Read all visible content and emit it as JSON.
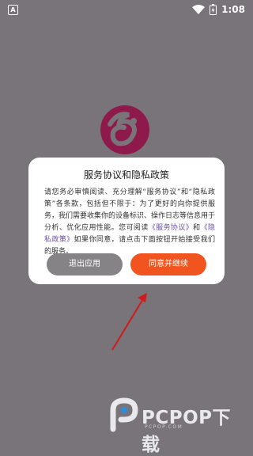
{
  "status_bar": {
    "left_badge": "A",
    "time": "1:08"
  },
  "dialog": {
    "title": "服务协议和隐私政策",
    "body_part1": "请您务必审慎阅读、充分理解“服务协议”和“隐私政策”各条款，包括但不限于：为了更好的向你提供服务，我们需要收集你的设备标识、操作日志等信息用于分析、优化应用性能。您可阅读",
    "link_service": "《服务协议》",
    "body_and": "和",
    "link_privacy": "《隐私政策》",
    "body_part2": "如果你同意，请点击下面按钮开始接受我们的服务。",
    "exit_label": "退出应用",
    "agree_label": "同意并继续"
  },
  "watermark": {
    "brand": "PCPOP下载",
    "sub": "PCPOP.COM"
  },
  "colors": {
    "background": "#79737a",
    "accent": "#f2541f",
    "exit_button": "#858386",
    "logo": "#8e1a4c",
    "annotation_arrow": "#d11a1a"
  }
}
